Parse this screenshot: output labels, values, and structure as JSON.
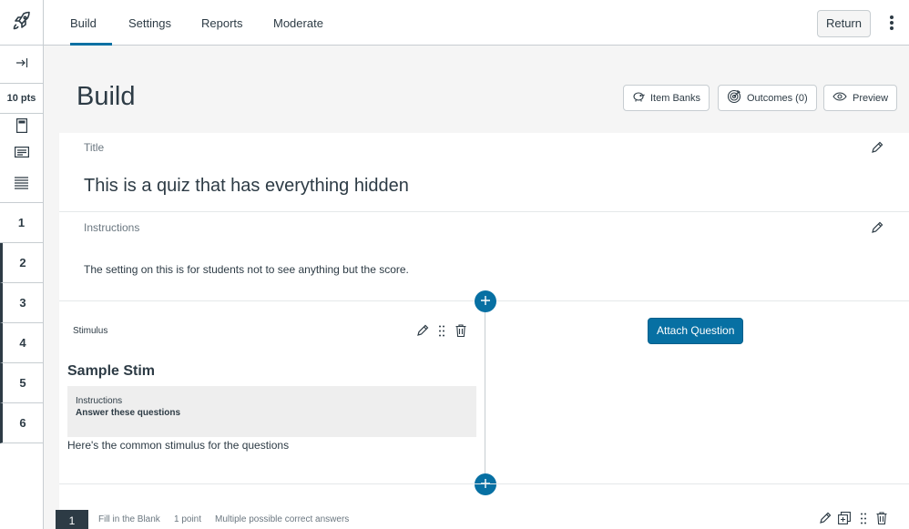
{
  "nav": {
    "tabs": [
      {
        "label": "Build",
        "active": true
      },
      {
        "label": "Settings",
        "active": false
      },
      {
        "label": "Reports",
        "active": false
      },
      {
        "label": "Moderate",
        "active": false
      }
    ],
    "return_label": "Return"
  },
  "rail": {
    "points": "10 pts",
    "questions": [
      "1",
      "2",
      "3",
      "4",
      "5",
      "6"
    ]
  },
  "header": {
    "title": "Build",
    "item_banks": "Item Banks",
    "outcomes": "Outcomes (0)",
    "preview": "Preview"
  },
  "quiz": {
    "title_label": "Title",
    "title": "This is a quiz that has everything hidden",
    "instructions_label": "Instructions",
    "instructions": "The setting on this is for students not to see anything but the score."
  },
  "stimulus": {
    "label": "Stimulus",
    "title": "Sample Stim",
    "instructions_label": "Instructions",
    "instructions_text": "Answer these questions",
    "body": "Here's the common stimulus for the questions",
    "attach_label": "Attach Question"
  },
  "question": {
    "number": "1",
    "type": "Fill in the Blank",
    "points": "1 point",
    "scoring": "Multiple possible correct answers"
  },
  "colors": {
    "accent": "#0770a3",
    "text": "#2d3b45",
    "border": "#c7cdd1"
  },
  "icons": [
    "rocket-icon",
    "expand-icon",
    "doc-icon",
    "card-icon",
    "list-icon",
    "pencil-icon",
    "drag-handle-icon",
    "trash-icon",
    "plus-icon",
    "piggy-bank-icon",
    "target-icon",
    "eye-icon",
    "copy-icon",
    "more-vertical-icon"
  ]
}
